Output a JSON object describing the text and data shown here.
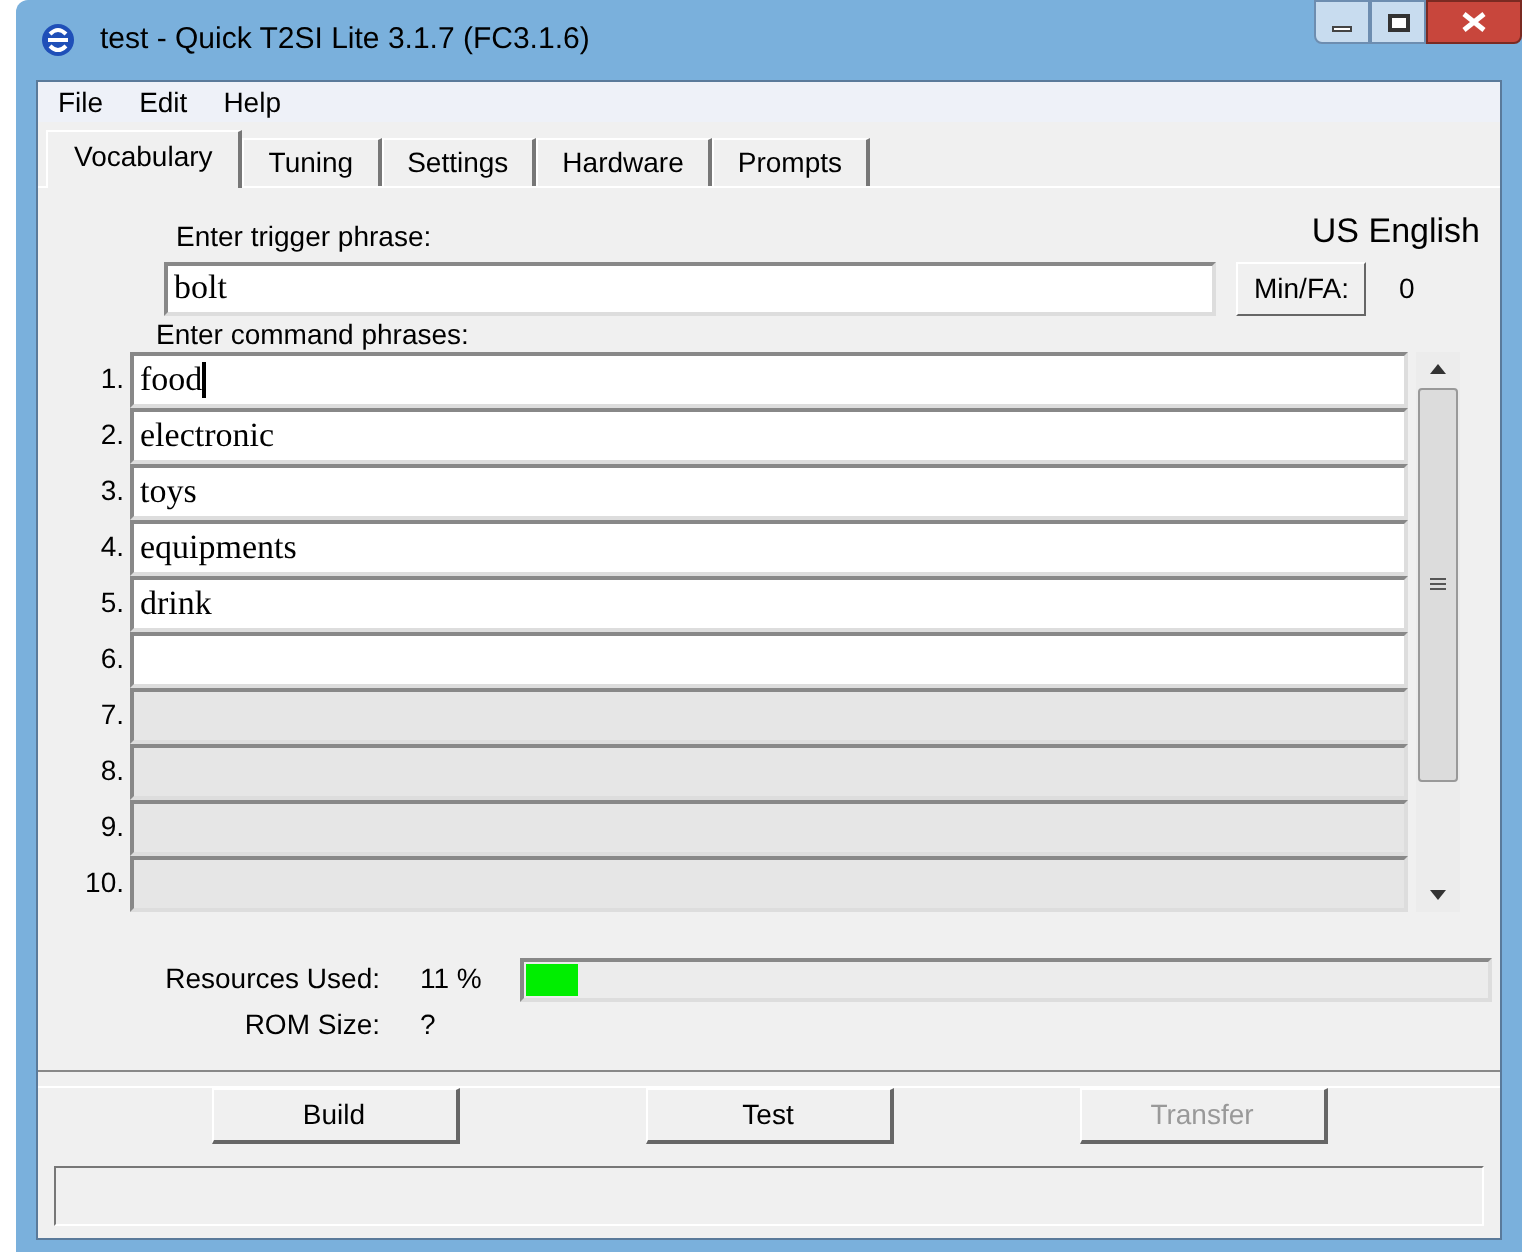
{
  "window": {
    "title": "test - Quick T2SI Lite 3.1.7 (FC3.1.6)"
  },
  "menu": [
    "File",
    "Edit",
    "Help"
  ],
  "tabs": [
    {
      "label": "Vocabulary",
      "selected": true
    },
    {
      "label": "Tuning",
      "selected": false
    },
    {
      "label": "Settings",
      "selected": false
    },
    {
      "label": "Hardware",
      "selected": false
    },
    {
      "label": "Prompts",
      "selected": false
    }
  ],
  "trigger": {
    "label": "Enter trigger phrase:",
    "value": "bolt",
    "language": "US English",
    "minfa_button": "Min/FA:",
    "minfa_value": "0"
  },
  "commands": {
    "label": "Enter command phrases:",
    "rows": [
      {
        "number": "1.",
        "value": "food",
        "enabled": true,
        "focused": true
      },
      {
        "number": "2.",
        "value": "electronic",
        "enabled": true,
        "focused": false
      },
      {
        "number": "3.",
        "value": "toys",
        "enabled": true,
        "focused": false
      },
      {
        "number": "4.",
        "value": "equipments",
        "enabled": true,
        "focused": false
      },
      {
        "number": "5.",
        "value": "drink",
        "enabled": true,
        "focused": false
      },
      {
        "number": "6.",
        "value": "",
        "enabled": true,
        "focused": false
      },
      {
        "number": "7.",
        "value": "",
        "enabled": false,
        "focused": false
      },
      {
        "number": "8.",
        "value": "",
        "enabled": false,
        "focused": false
      },
      {
        "number": "9.",
        "value": "",
        "enabled": false,
        "focused": false
      },
      {
        "number": "10.",
        "value": "",
        "enabled": false,
        "focused": false
      }
    ]
  },
  "resources": {
    "label": "Resources Used:",
    "reading": "11 %",
    "level": 0.055,
    "rom_label": "ROM Size:",
    "rom_value": "?"
  },
  "buttons": [
    {
      "label": "Build",
      "disabled": false
    },
    {
      "label": "Test",
      "disabled": false
    },
    {
      "label": "Transfer",
      "disabled": true
    }
  ]
}
